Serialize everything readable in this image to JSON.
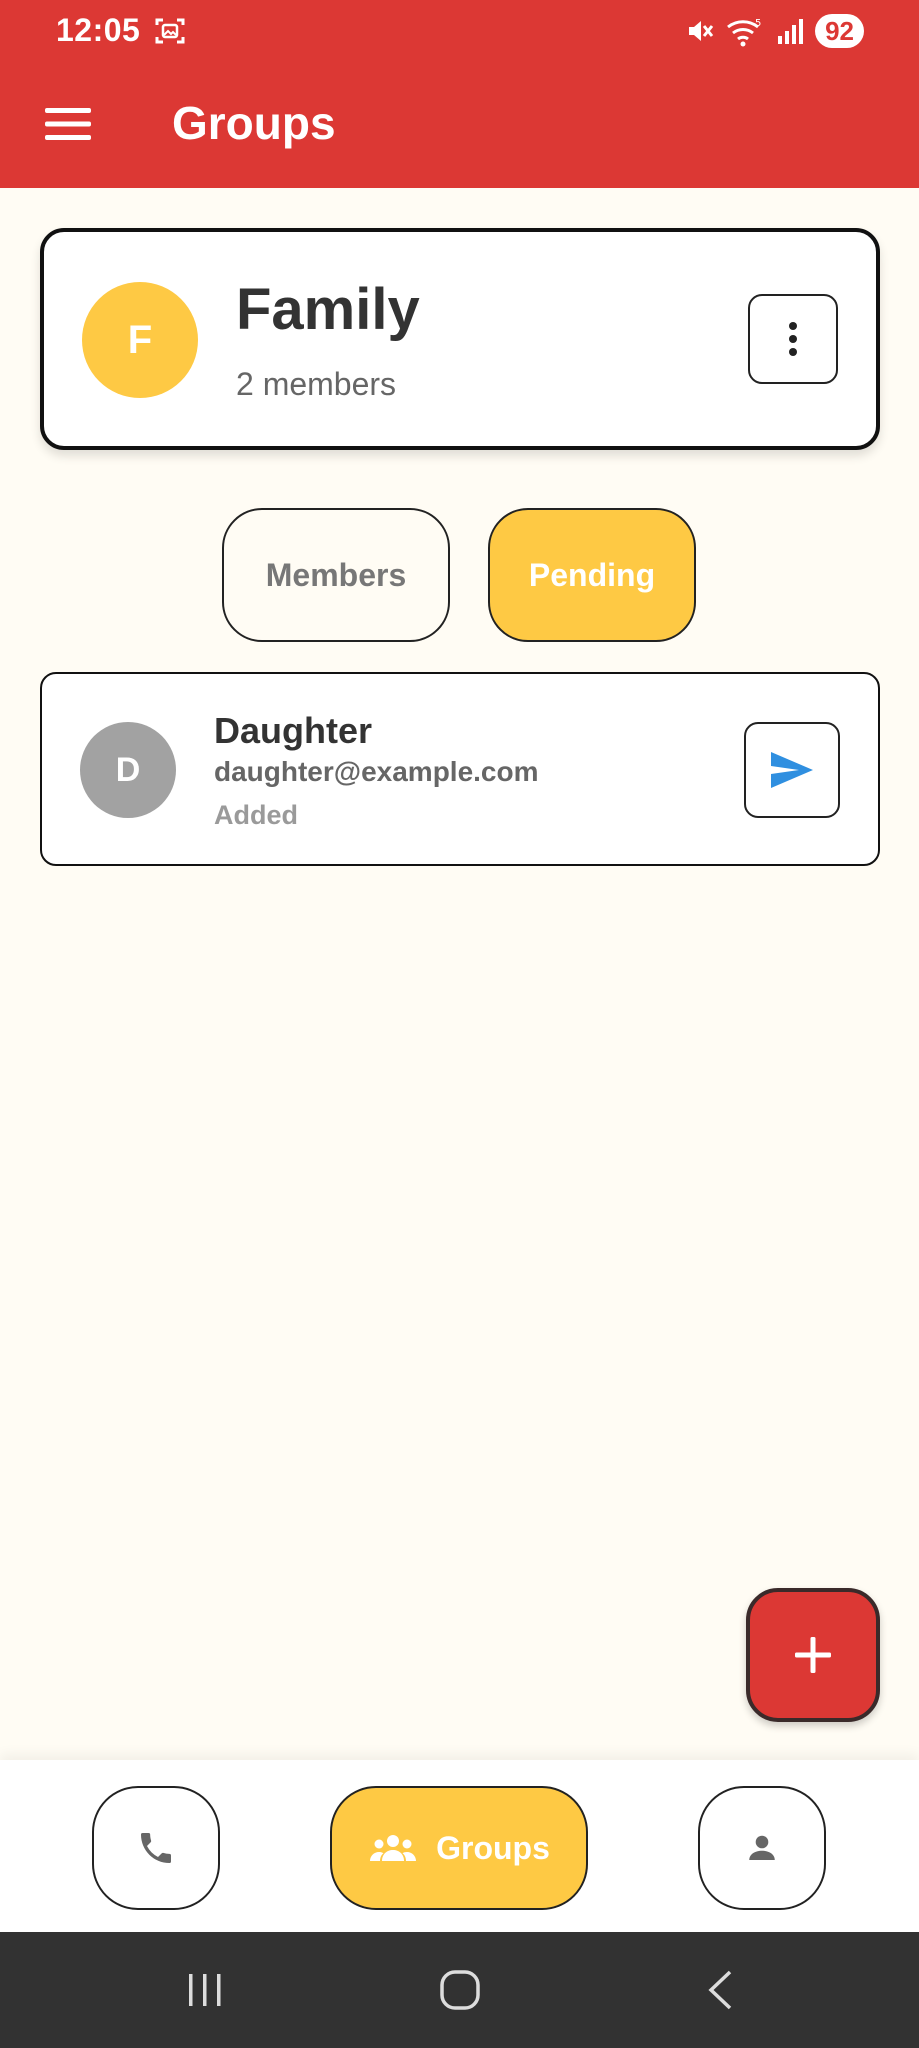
{
  "status_bar": {
    "time": "12:05",
    "battery": "92",
    "icons": [
      "screenshot-icon",
      "mute-icon",
      "wifi-icon",
      "signal-icon"
    ]
  },
  "app_bar": {
    "title": "Groups",
    "menu_icon": "menu-icon"
  },
  "group": {
    "initial": "F",
    "name": "Family",
    "member_count": "2 members",
    "avatar_color": "#fec944"
  },
  "tabs": [
    {
      "label": "Members",
      "selected": false
    },
    {
      "label": "Pending",
      "selected": true
    }
  ],
  "members": [
    {
      "initial": "D",
      "name": "Daughter",
      "email": "daughter@example.com",
      "status": "Added"
    }
  ],
  "fab": {
    "icon": "plus-icon"
  },
  "bottom_nav": [
    {
      "icon": "phone-icon",
      "label": ""
    },
    {
      "icon": "groups-icon",
      "label": "Groups",
      "selected": true
    },
    {
      "icon": "person-icon",
      "label": ""
    }
  ],
  "colors": {
    "primary": "#dc3834",
    "accent": "#fec944",
    "background": "#fffcf4",
    "send_icon": "#2f8fe0"
  }
}
